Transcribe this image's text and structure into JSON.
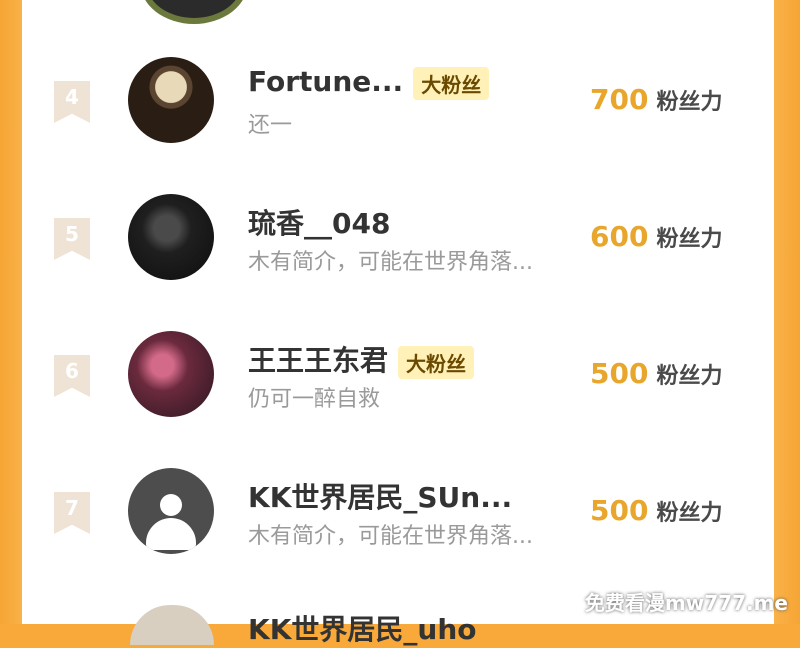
{
  "list": {
    "unit_label": "粉丝力",
    "rows": [
      {
        "rank": "4",
        "name": "Fortune...",
        "badge": "大粉丝",
        "bio": "还一",
        "fans": "700"
      },
      {
        "rank": "5",
        "name": "琉香__048",
        "badge": "",
        "bio": "木有简介，可能在世界角落...",
        "fans": "600"
      },
      {
        "rank": "6",
        "name": "王王王东君",
        "badge": "大粉丝",
        "bio": "仍可一醉自救",
        "fans": "500"
      },
      {
        "rank": "7",
        "name": "KK世界居民_SUn...",
        "badge": "",
        "bio": "木有简介，可能在世界角落...",
        "fans": "500"
      }
    ],
    "next_partial_name": "KK世界居民_uho"
  },
  "colors": {
    "accent": "#e8a72c",
    "frame": "#f8a93a",
    "badge_bg": "#fff1b8"
  },
  "watermark": "免费看漫mw777.me"
}
